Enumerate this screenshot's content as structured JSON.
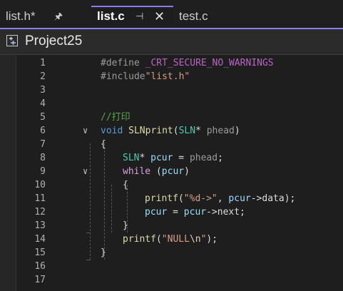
{
  "tabs": [
    {
      "label": "list.h*",
      "pin": "🖈"
    },
    {
      "label": "list.c",
      "pin": "⊣",
      "close": "✕"
    },
    {
      "label": "test.c"
    }
  ],
  "project": {
    "title": "Project25"
  },
  "colors": {
    "accent": "#8a7cf0",
    "background": "#1e1e1e"
  },
  "line_numbers": [
    "1",
    "2",
    "3",
    "4",
    "5",
    "6",
    "7",
    "8",
    "9",
    "10",
    "11",
    "12",
    "13",
    "14",
    "15",
    "16",
    "17"
  ],
  "code": {
    "l1": {
      "a": "#define",
      "b": " ",
      "c": "_CRT_SECURE_NO_WARNINGS"
    },
    "l2": {
      "a": "#include",
      "b": "\"list.h\""
    },
    "l5": {
      "a": "//打印"
    },
    "l6": {
      "a": "void",
      "b": " ",
      "c": "SLNprint",
      "d": "(",
      "e": "SLN",
      "f": "* ",
      "g": "phead",
      "h": ")"
    },
    "l7": {
      "a": "{"
    },
    "l8": {
      "a": "SLN",
      "b": "* ",
      "c": "pcur",
      "d": " = ",
      "e": "phead",
      "f": ";"
    },
    "l9": {
      "a": "while",
      "b": " (",
      "c": "pcur",
      "d": ")"
    },
    "l10": {
      "a": "{"
    },
    "l11": {
      "a": "printf",
      "b": "(",
      "c": "\"%d->\"",
      "d": ", ",
      "e": "pcur",
      "f": "->",
      "g": "data",
      "h": ");"
    },
    "l12": {
      "a": "pcur",
      "b": " = ",
      "c": "pcur",
      "d": "->",
      "e": "next",
      "f": ";"
    },
    "l13": {
      "a": "}"
    },
    "l14": {
      "a": "printf",
      "b": "(",
      "c": "\"NULL",
      "d": "\\n",
      "e": "\"",
      "f": ");"
    },
    "l15": {
      "a": "}"
    }
  },
  "fold_glyph": "∨"
}
